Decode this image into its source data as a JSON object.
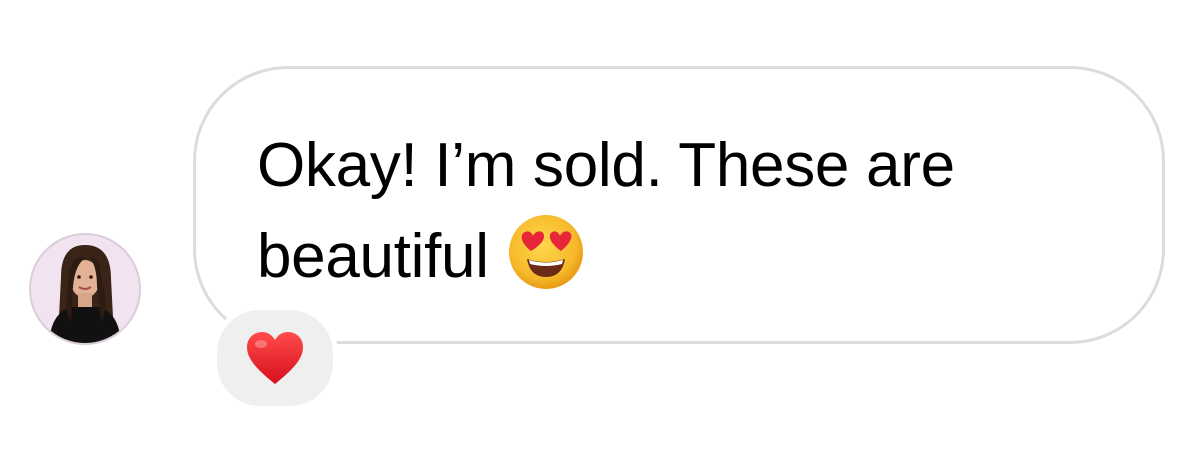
{
  "message": {
    "line1": "Okay! I’m sold. These are",
    "line2": "beautiful",
    "emoji": "smiling-face-with-heart-eyes"
  },
  "reaction": {
    "emoji": "red-heart"
  },
  "sender": {
    "avatar": "profile-photo"
  },
  "colors": {
    "bubble_border": "#dcdcdc",
    "reaction_bg": "#efefef",
    "text": "#000000",
    "heart": "#e0202e",
    "emoji_face": "#f7c12f"
  }
}
